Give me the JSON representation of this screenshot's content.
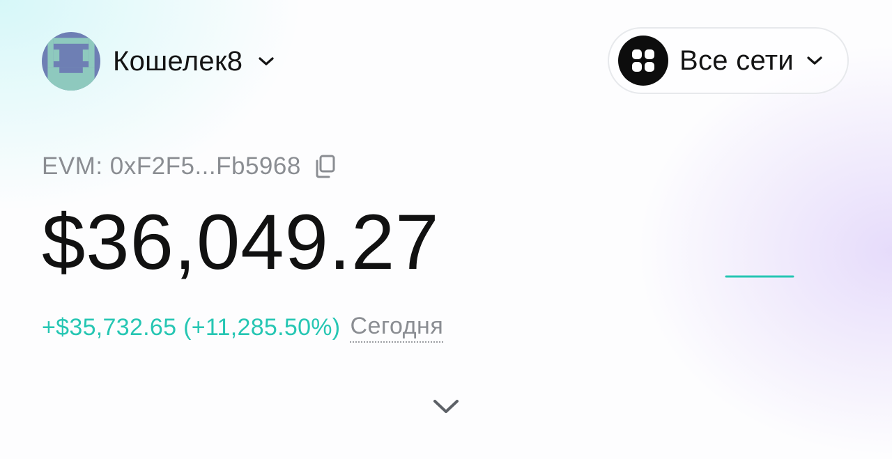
{
  "wallet": {
    "name": "Кошелек8",
    "avatar_icon": "pixel-avatar-icon",
    "avatar_colors": [
      "#6e7fb4",
      "#8ec9be"
    ]
  },
  "network": {
    "label": "Все сети",
    "icon": "grid-icon"
  },
  "address": {
    "text": "EVM: 0xF2F5...Fb5968",
    "copy_icon": "copy-icon"
  },
  "balance": {
    "value": "$36,049.27"
  },
  "change": {
    "value": "+$35,732.65 (+11,285.50%)",
    "period": "Сегодня"
  },
  "colors": {
    "accent": "#26c6b3",
    "muted": "#8a8d92",
    "text": "#141414"
  }
}
